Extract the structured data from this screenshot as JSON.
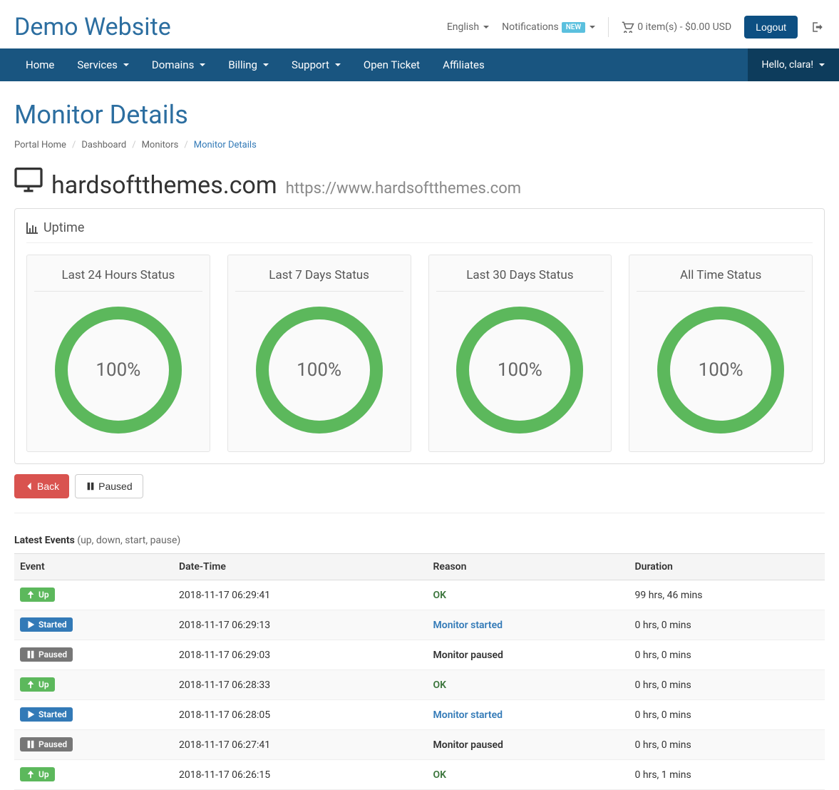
{
  "brand": "Demo Website",
  "topbar": {
    "language": "English",
    "notifications": "Notifications",
    "notif_badge": "NEW",
    "cart": "0 item(s) - $0.00 USD",
    "logout": "Logout"
  },
  "nav": {
    "items": [
      "Home",
      "Services",
      "Domains",
      "Billing",
      "Support",
      "Open Ticket",
      "Affiliates"
    ],
    "user": "Hello, clara!"
  },
  "page": {
    "title": "Monitor Details",
    "breadcrumb": [
      "Portal Home",
      "Dashboard",
      "Monitors",
      "Monitor Details"
    ]
  },
  "monitor": {
    "name": "hardsoftthemes.com",
    "url": "https://www.hardsoftthemes.com"
  },
  "uptime_panel": {
    "title": "Uptime",
    "cards": [
      {
        "title": "Last 24 Hours Status",
        "pct": "100%",
        "value": 100
      },
      {
        "title": "Last 7 Days Status",
        "pct": "100%",
        "value": 100
      },
      {
        "title": "Last 30 Days Status",
        "pct": "100%",
        "value": 100
      },
      {
        "title": "All Time Status",
        "pct": "100%",
        "value": 100
      }
    ]
  },
  "buttons": {
    "back": "Back",
    "paused": "Paused"
  },
  "events": {
    "heading": "Latest Events",
    "sub": "(up, down, start, pause)",
    "columns": [
      "Event",
      "Date-Time",
      "Reason",
      "Duration"
    ],
    "rows": [
      {
        "type": "up",
        "label": "Up",
        "dt": "2018-11-17 06:29:41",
        "reason": "OK",
        "rclass": "txt-green",
        "dur": "99 hrs, 46 mins"
      },
      {
        "type": "started",
        "label": "Started",
        "dt": "2018-11-17 06:29:13",
        "reason": "Monitor started",
        "rclass": "txt-blue",
        "dur": "0 hrs, 0 mins"
      },
      {
        "type": "paused",
        "label": "Paused",
        "dt": "2018-11-17 06:29:03",
        "reason": "Monitor paused",
        "rclass": "txt-bold",
        "dur": "0 hrs, 0 mins"
      },
      {
        "type": "up",
        "label": "Up",
        "dt": "2018-11-17 06:28:33",
        "reason": "OK",
        "rclass": "txt-green",
        "dur": "0 hrs, 0 mins"
      },
      {
        "type": "started",
        "label": "Started",
        "dt": "2018-11-17 06:28:05",
        "reason": "Monitor started",
        "rclass": "txt-blue",
        "dur": "0 hrs, 0 mins"
      },
      {
        "type": "paused",
        "label": "Paused",
        "dt": "2018-11-17 06:27:41",
        "reason": "Monitor paused",
        "rclass": "txt-bold",
        "dur": "0 hrs, 0 mins"
      },
      {
        "type": "up",
        "label": "Up",
        "dt": "2018-11-17 06:26:15",
        "reason": "OK",
        "rclass": "txt-green",
        "dur": "0 hrs, 1 mins"
      }
    ]
  },
  "chart_data": [
    {
      "type": "pie",
      "title": "Last 24 Hours Status",
      "categories": [
        "Up",
        "Down"
      ],
      "values": [
        100,
        0
      ]
    },
    {
      "type": "pie",
      "title": "Last 7 Days Status",
      "categories": [
        "Up",
        "Down"
      ],
      "values": [
        100,
        0
      ]
    },
    {
      "type": "pie",
      "title": "Last 30 Days Status",
      "categories": [
        "Up",
        "Down"
      ],
      "values": [
        100,
        0
      ]
    },
    {
      "type": "pie",
      "title": "All Time Status",
      "categories": [
        "Up",
        "Down"
      ],
      "values": [
        100,
        0
      ]
    }
  ]
}
